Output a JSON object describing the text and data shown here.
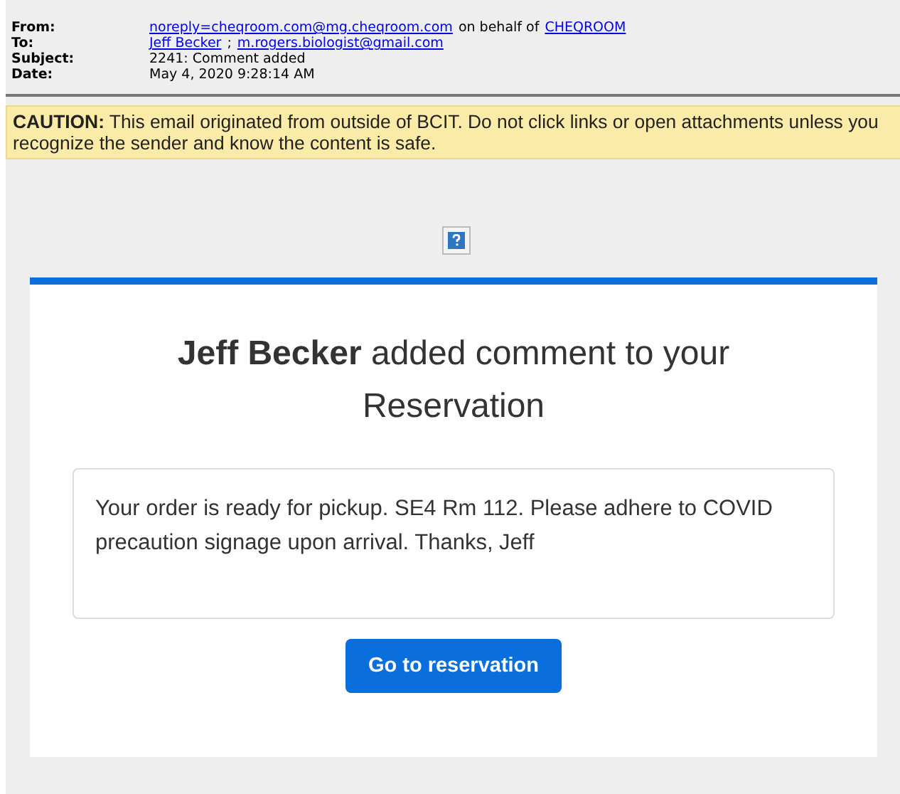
{
  "header": [
    {
      "label": "From:",
      "value": [
        {
          "kind": "link",
          "text": "noreply=cheqroom.com@mg.cheqroom.com"
        },
        {
          "kind": "text",
          "text": "on behalf of"
        },
        {
          "kind": "link",
          "text": "CHEQROOM"
        }
      ]
    },
    {
      "label": "To:",
      "value": [
        {
          "kind": "link",
          "text": "Jeff Becker"
        },
        {
          "kind": "text",
          "text": ";"
        },
        {
          "kind": "link",
          "text": "m.rogers.biologist@gmail.com"
        }
      ]
    },
    {
      "label": "Subject:",
      "value": [
        {
          "kind": "text",
          "text": "2241: Comment added"
        }
      ]
    },
    {
      "label": "Date:",
      "value": [
        {
          "kind": "text",
          "text": "May 4, 2020 9:28:14 AM"
        }
      ]
    }
  ],
  "caution": "**CAUTION:** This email originated from outside of BCIT. Do not click links or open attachments unless you recognize the sender and know the content is safe.",
  "card": {
    "heading": "**Jeff Becker** added comment to your Reservation",
    "comment": "Your order is ready for pickup. SE4 Rm 112. Please adhere to COVID precaution signage upon arrival. Thanks, Jeff",
    "button": "Go to reservation"
  }
}
